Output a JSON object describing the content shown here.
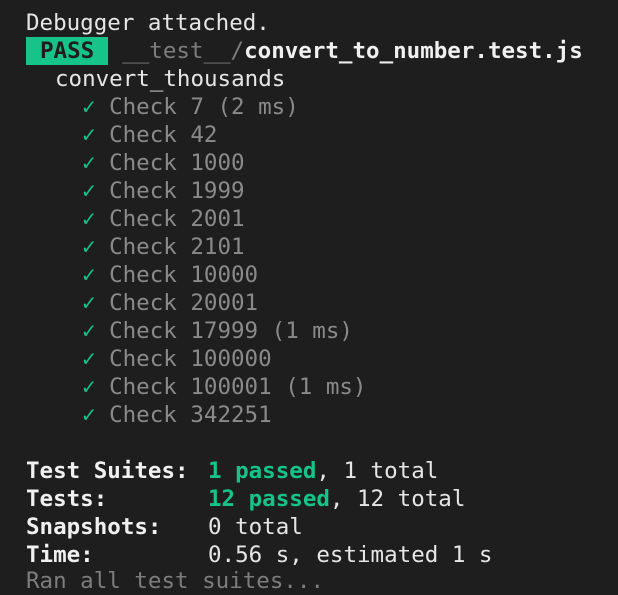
{
  "header": {
    "debugger_text": "Debugger attached."
  },
  "result": {
    "badge": "PASS",
    "path_dir": "__test__/",
    "path_file": "convert_to_number.test.js"
  },
  "suite": {
    "name": "convert_thousands",
    "check_glyph": "✓",
    "tests": [
      {
        "name": "Check 7",
        "time": "(2 ms)"
      },
      {
        "name": "Check 42",
        "time": ""
      },
      {
        "name": "Check 1000",
        "time": ""
      },
      {
        "name": "Check 1999",
        "time": ""
      },
      {
        "name": "Check 2001",
        "time": ""
      },
      {
        "name": "Check 2101",
        "time": ""
      },
      {
        "name": "Check 10000",
        "time": ""
      },
      {
        "name": "Check 20001",
        "time": ""
      },
      {
        "name": "Check 17999",
        "time": "(1 ms)"
      },
      {
        "name": "Check 100000",
        "time": ""
      },
      {
        "name": "Check 100001",
        "time": "(1 ms)"
      },
      {
        "name": "Check 342251",
        "time": ""
      }
    ]
  },
  "summary": {
    "suites_label": "Test Suites:",
    "suites_passed": "1 passed",
    "suites_rest": ", 1 total",
    "tests_label": "Tests:",
    "tests_passed": "12 passed",
    "tests_rest": ", 12 total",
    "snapshots_label": "Snapshots:",
    "snapshots_value": "0 total",
    "time_label": "Time:",
    "time_value": "0.56 s, estimated 1 s"
  },
  "footer": {
    "partial_text": "Ran all test suites..."
  },
  "colors": {
    "pass_green": "#16c48a",
    "background": "#1e1e1e"
  }
}
